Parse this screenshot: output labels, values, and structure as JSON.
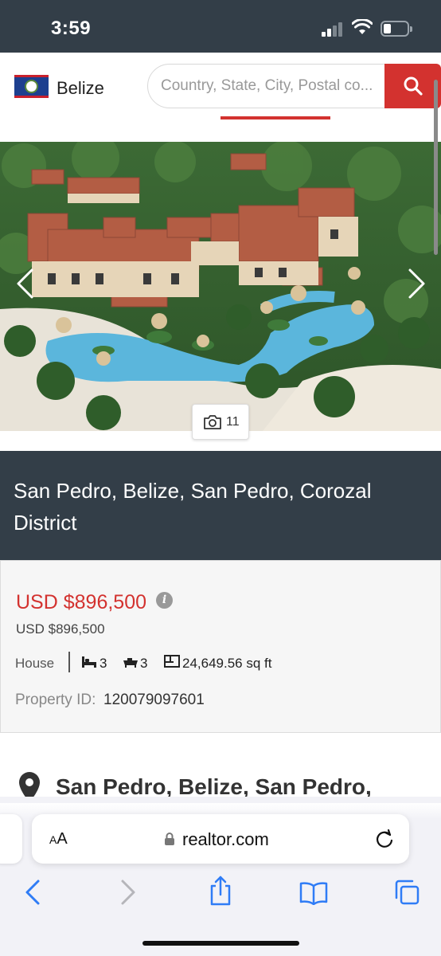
{
  "status_bar": {
    "time": "3:59"
  },
  "header": {
    "country": "Belize",
    "search_placeholder": "Country, State, City, Postal co..."
  },
  "gallery": {
    "photo_count": "11"
  },
  "location_banner": {
    "text": "San Pedro, Belize, San Pedro, Corozal District"
  },
  "listing": {
    "price_primary": "USD $896,500",
    "price_secondary": "USD $896,500",
    "property_type": "House",
    "beds": "3",
    "baths": "3",
    "area": "24,649.56 sq ft",
    "property_id_label": "Property ID:",
    "property_id_value": "120079097601"
  },
  "address": {
    "heading": "San Pedro, Belize, San Pedro,"
  },
  "browser": {
    "text_size_label_small": "A",
    "text_size_label_large": "A",
    "url": "realtor.com"
  },
  "colors": {
    "accent_red": "#d3322f",
    "dark_banner": "#333e48",
    "safari_blue": "#2f7cf6"
  }
}
